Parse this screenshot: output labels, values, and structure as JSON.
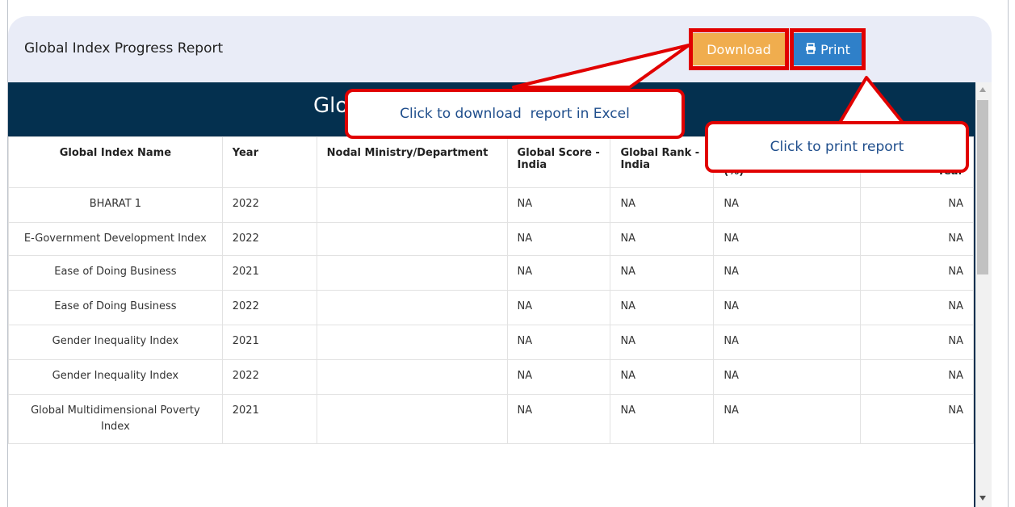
{
  "report": {
    "title": "Global Index Progress Report",
    "band_title": "Glo",
    "download_label": "Download",
    "print_label": "Print"
  },
  "table": {
    "headers": [
      "Global Index Name",
      "Year",
      "Nodal Ministry/Department",
      "Global Score - India",
      "Global Rank - India",
      "(%)",
      "Year"
    ],
    "rows": [
      [
        "BHARAT 1",
        "2022",
        "",
        "NA",
        "NA",
        "NA",
        "NA"
      ],
      [
        "E-Government Development Index",
        "2022",
        "",
        "NA",
        "NA",
        "NA",
        "NA"
      ],
      [
        "Ease of Doing Business",
        "2021",
        "",
        "NA",
        "NA",
        "NA",
        "NA"
      ],
      [
        "Ease of Doing Business",
        "2022",
        "",
        "NA",
        "NA",
        "NA",
        "NA"
      ],
      [
        "Gender Inequality Index",
        "2021",
        "",
        "NA",
        "NA",
        "NA",
        "NA"
      ],
      [
        "Gender Inequality Index",
        "2022",
        "",
        "NA",
        "NA",
        "NA",
        "NA"
      ],
      [
        "Global Multidimensional Poverty Index",
        "2021",
        "",
        "NA",
        "NA",
        "NA",
        "NA"
      ]
    ]
  },
  "callouts": {
    "download_hint": "Click to download  report in Excel",
    "print_hint": "Click to print report"
  },
  "colors": {
    "highlight": "#e10000",
    "header_band": "#04304f",
    "download_button": "#f0ad4e",
    "print_button": "#2f80c9"
  },
  "icons": {
    "print": "printer-icon"
  }
}
